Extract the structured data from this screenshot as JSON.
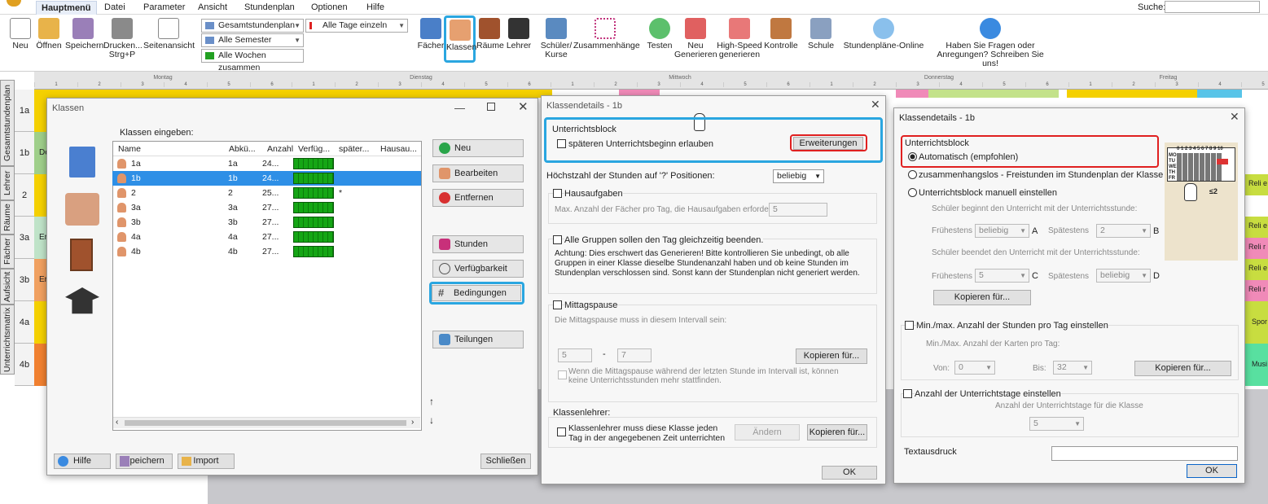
{
  "menu": {
    "items": [
      "Hauptmenü",
      "Datei",
      "Parameter",
      "Ansicht",
      "Stundenplan",
      "Optionen",
      "Hilfe"
    ],
    "search_label": "Suche:"
  },
  "ribbon": {
    "neu": "Neu",
    "oeffnen": "Öffnen",
    "speichern": "Speichern",
    "drucken": "Drucken...",
    "drucken_short": "Strg+P",
    "seitenansicht": "Seitenansicht",
    "select1": "Gesamtstundenplan",
    "select2": "Alle Semester",
    "select3": "Alle Wochen zusammen",
    "select4": "Alle Tage einzeln",
    "faecher": "Fächer",
    "klassen": "Klassen",
    "raeume": "Räume",
    "lehrer": "Lehrer",
    "schueler": "Schüler/",
    "kurse": "Kurse",
    "zusammenhaenge": "Zusammenhänge",
    "testen": "Testen",
    "neu_gen1": "Neu",
    "neu_gen2": "Generieren",
    "hs1": "High-Speed",
    "hs2": "generieren",
    "kontrolle": "Kontrolle",
    "schule": "Schule",
    "online": "Stundenpläne-Online",
    "fragen1": "Haben Sie Fragen oder",
    "fragen2": "Anregungen? Schreiben Sie uns!"
  },
  "timetable": {
    "days": [
      "Montag",
      "Dienstag",
      "Mittwoch",
      "Donnerstag",
      "Freitag"
    ],
    "periods": [
      "1",
      "2",
      "3",
      "4",
      "5",
      "6"
    ],
    "side_tabs": [
      "Gesamtstundenplan",
      "Lehrer",
      "Räume",
      "Fächer",
      "Aufsicht",
      "Unterrichtsmatrix"
    ],
    "rows": [
      "1a",
      "1b",
      "2",
      "3a",
      "3b",
      "4a",
      "4b"
    ],
    "row_snippets": [
      "",
      "De",
      "",
      "Er",
      "Er",
      "",
      ""
    ],
    "right_snippets": [
      "",
      "",
      "Reli e",
      "Reli e",
      "Reli e",
      "Spor",
      "Musi"
    ],
    "right_snippets2": [
      "",
      "",
      "Reli r",
      "Reli r",
      "Reli r",
      "",
      ""
    ]
  },
  "klassen": {
    "title": "Klassen",
    "label": "Klassen eingeben:",
    "columns": [
      "Name",
      "Abkü...",
      "Anzahl",
      "Verfüg...",
      "später...",
      "Hausau..."
    ],
    "rows": [
      {
        "name": "1a",
        "abk": "1a",
        "anzahl": "24...",
        "spaeter": ""
      },
      {
        "name": "1b",
        "abk": "1b",
        "anzahl": "24...",
        "spaeter": ""
      },
      {
        "name": "2",
        "abk": "2",
        "anzahl": "25...",
        "spaeter": "*"
      },
      {
        "name": "3a",
        "abk": "3a",
        "anzahl": "27...",
        "spaeter": ""
      },
      {
        "name": "3b",
        "abk": "3b",
        "anzahl": "27...",
        "spaeter": ""
      },
      {
        "name": "4a",
        "abk": "4a",
        "anzahl": "27...",
        "spaeter": ""
      },
      {
        "name": "4b",
        "abk": "4b",
        "anzahl": "27...",
        "spaeter": ""
      }
    ],
    "buttons": {
      "neu": "Neu",
      "bearbeiten": "Bearbeiten",
      "entfernen": "Entfernen",
      "stunden": "Stunden",
      "verfuegbarkeit": "Verfügbarkeit",
      "bedingungen": "Bedingungen",
      "teilungen": "Teilungen"
    },
    "footer": {
      "hilfe": "Hilfe",
      "speichern": "Speichern",
      "import": "Import",
      "schliessen": "Schließen"
    }
  },
  "details1": {
    "title": "Klassendetails - 1b",
    "ub_title": "Unterrichtsblock",
    "ub_check": "späteren Unterrichtsbeginn erlauben",
    "erweiterungen": "Erweiterungen",
    "hoechst": "Höchstzahl der Stunden auf '?' Positionen:",
    "hoechst_val": "beliebig",
    "hausaufgaben": "Hausaufgaben",
    "ha_text": "Max. Anzahl der Fächer pro Tag, die  Hausaufgaben erfordern",
    "ha_val": "5",
    "gruppen": "Alle Gruppen sollen den Tag gleichzeitig beenden.",
    "gruppen_text": "Achtung: Dies erschwert das Generieren! Bitte kontrollieren Sie unbedingt, ob alle Gruppen in einer Klasse dieselbe Stundenanzahl haben und ob keine Stunden im Stundenplan verschlossen sind. Sonst kann der Stundenplan nicht generiert werden.",
    "mittag": "Mittagspause",
    "mittag_text": "Die Mittagspause muss in diesem Intervall sein:",
    "m_from": "5",
    "m_dash": "-",
    "m_to": "7",
    "kopieren": "Kopieren für...",
    "mittag_chk": "Wenn die Mittagspause während der letzten Stunde im Intervall ist, können keine Unterrichtsstunden mehr stattfinden.",
    "kl_title": "Klassenlehrer:",
    "kl_chk": "Klassenlehrer muss diese Klasse jeden Tag in der angegebenen Zeit unterrichten",
    "aendern": "Ändern",
    "ok": "OK"
  },
  "details2": {
    "title": "Klassendetails - 1b",
    "ub_title": "Unterrichtsblock",
    "auto": "Automatisch (empfohlen)",
    "zus": "zusammenhangslos - Freistunden im Stundenplan der Klasse ignor",
    "manuell": "Unterrichtsblock manuell einstellen",
    "beginnt": "Schüler beginnt den Unterricht mit der Unterrichtsstunde:",
    "fruehestens": "Frühestens",
    "spaetestens": "Spätestens",
    "v_beliebig": "beliebig",
    "a": "A",
    "v_2": "2",
    "b": "B",
    "beendet": "Schüler beendet den Unterricht mit der Unterrichtsstunde:",
    "v_5": "5",
    "c": "C",
    "d": "D",
    "kopieren": "Kopieren für...",
    "minmax": "Min./max. Anzahl der Stunden pro Tag einstellen",
    "minmax_text": "Min./Max. Anzahl der Karten pro Tag:",
    "von": "Von:",
    "von_val": "0",
    "bis": "Bis:",
    "bis_val": "32",
    "anzahl": "Anzahl der Unterrichtstage einstellen",
    "anzahl_text": "Anzahl der Unterrichtstage für die Klasse",
    "anzahl_val": "5",
    "textausdruck": "Textausdruck",
    "ok": "OK",
    "mini_days": [
      "MO",
      "TU",
      "WE",
      "TH",
      "FR"
    ],
    "mini_head": "0 1 2 3 4 5 6 7 8 9 10",
    "mini_label": "≤2"
  }
}
